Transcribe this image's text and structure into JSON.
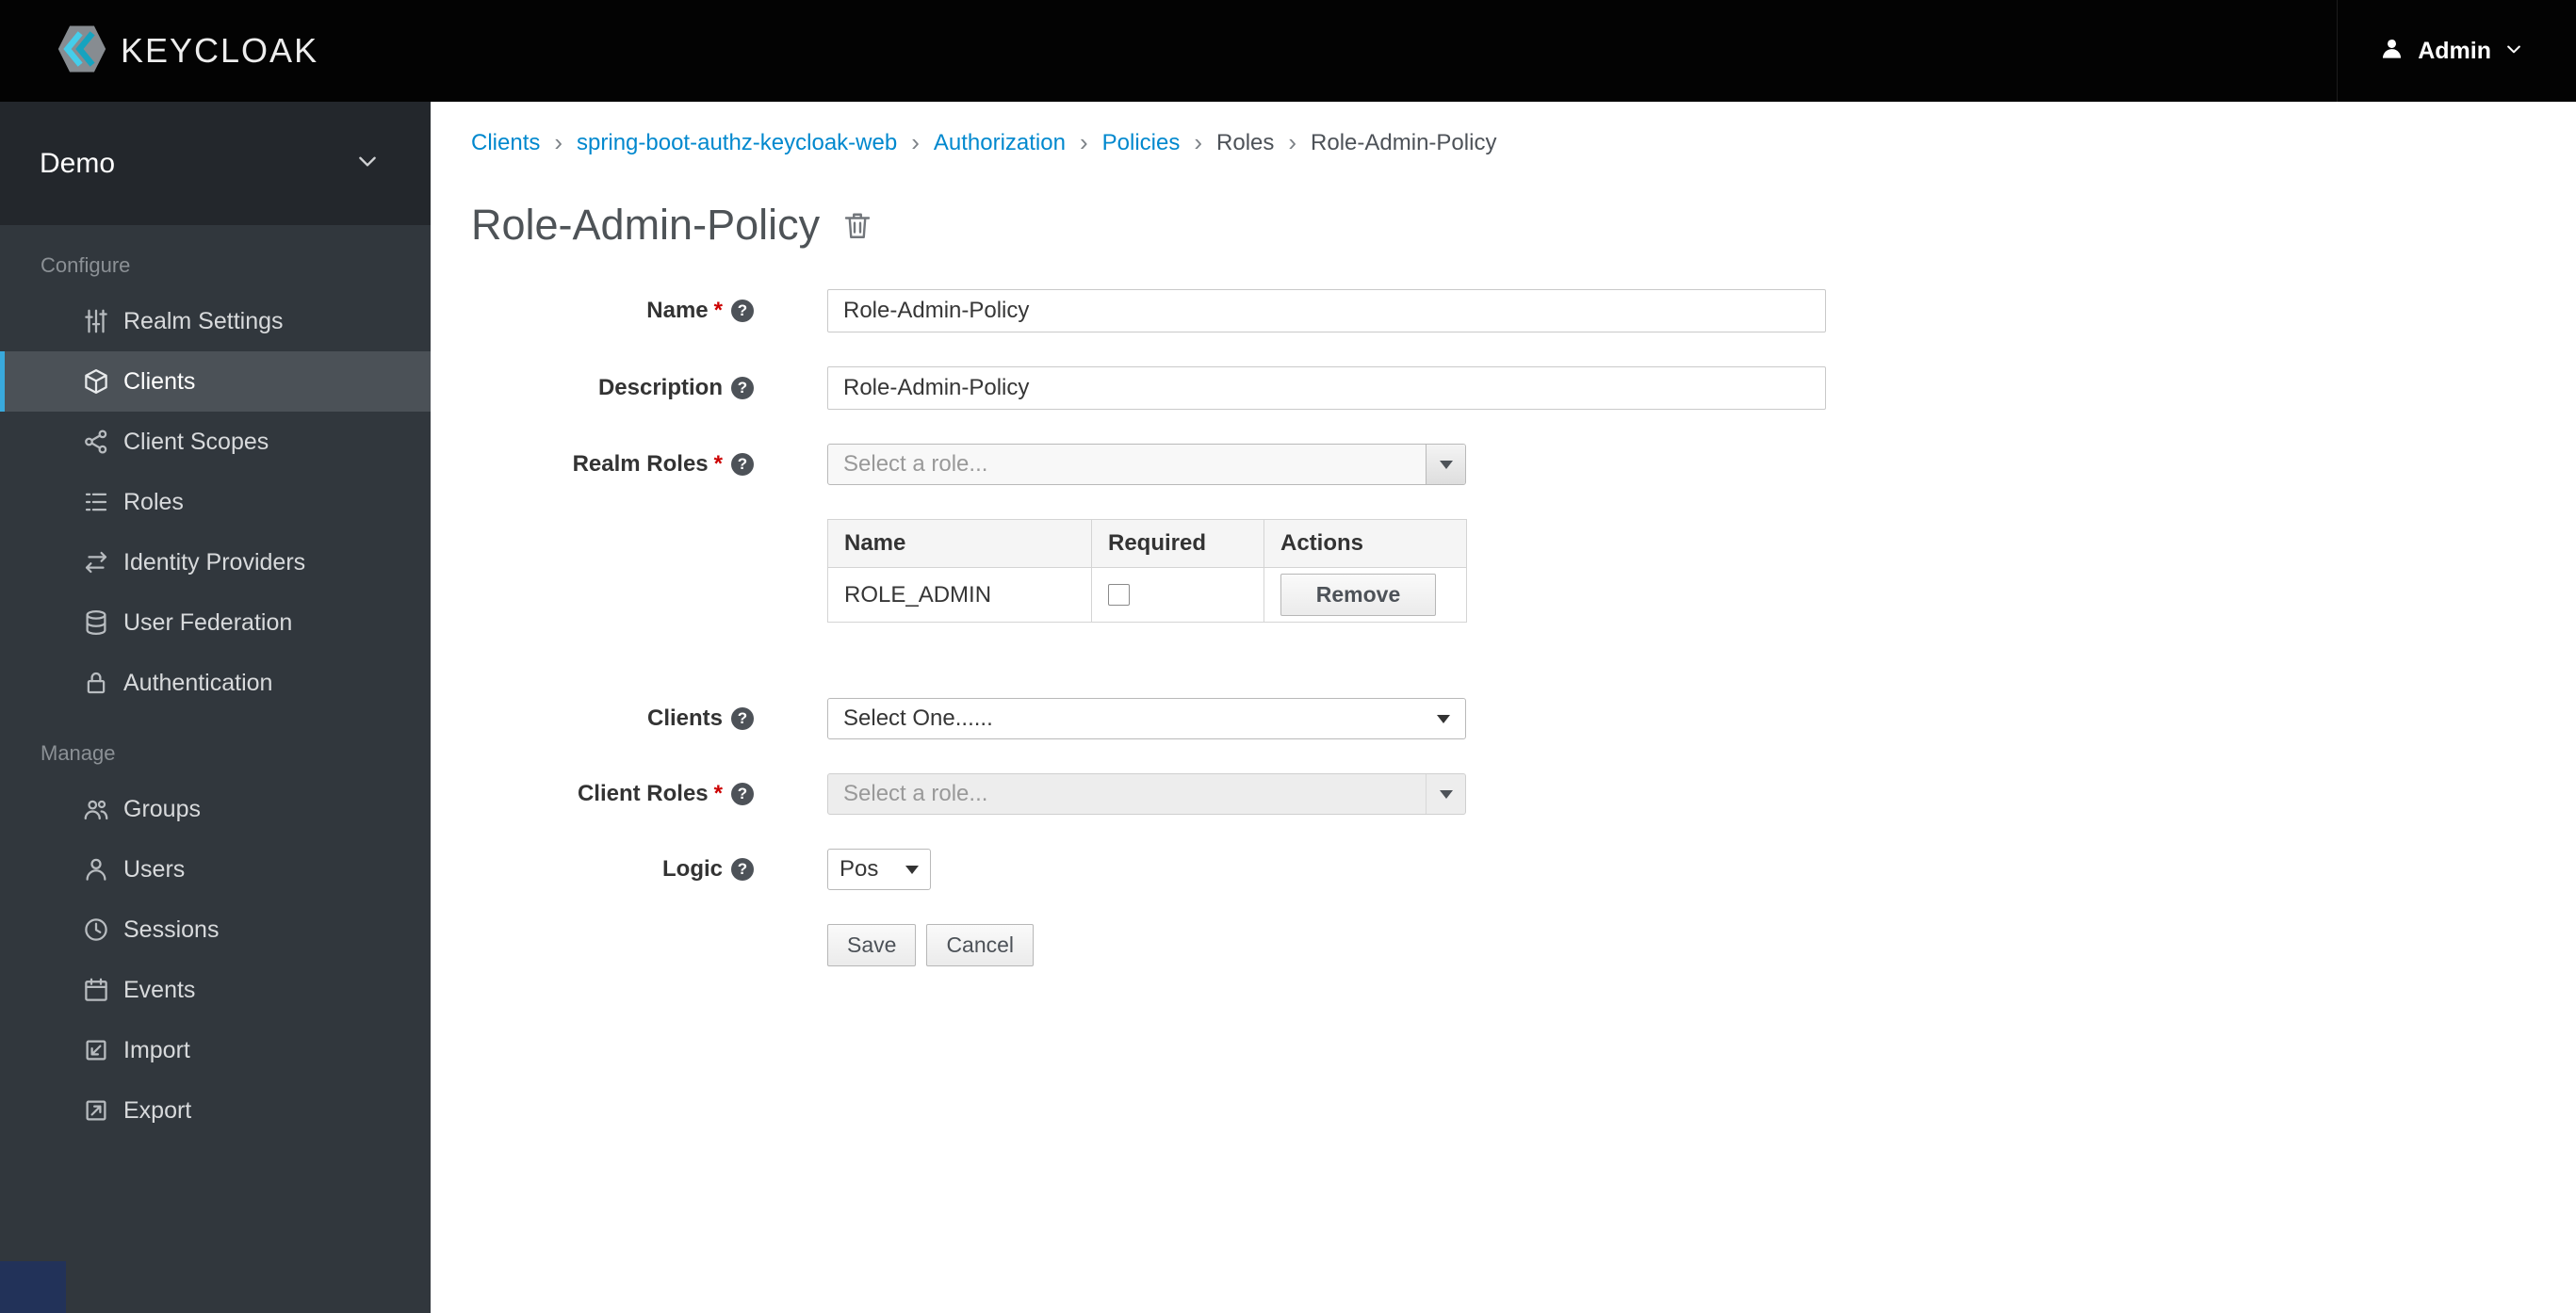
{
  "topbar": {
    "logo_text": "KEYCLOAK",
    "user_menu_label": "Admin"
  },
  "sidebar": {
    "realm_selector": {
      "label": "Demo"
    },
    "sections": [
      {
        "label": "Configure",
        "items": [
          {
            "label": "Realm Settings",
            "icon": "sliders-icon",
            "active": false
          },
          {
            "label": "Clients",
            "icon": "cube-icon",
            "active": true
          },
          {
            "label": "Client Scopes",
            "icon": "share-nodes-icon",
            "active": false
          },
          {
            "label": "Roles",
            "icon": "list-icon",
            "active": false
          },
          {
            "label": "Identity Providers",
            "icon": "exchange-icon",
            "active": false
          },
          {
            "label": "User Federation",
            "icon": "database-icon",
            "active": false
          },
          {
            "label": "Authentication",
            "icon": "lock-icon",
            "active": false
          }
        ]
      },
      {
        "label": "Manage",
        "items": [
          {
            "label": "Groups",
            "icon": "users-group-icon",
            "active": false
          },
          {
            "label": "Users",
            "icon": "user-icon",
            "active": false
          },
          {
            "label": "Sessions",
            "icon": "clock-icon",
            "active": false
          },
          {
            "label": "Events",
            "icon": "calendar-icon",
            "active": false
          },
          {
            "label": "Import",
            "icon": "import-icon",
            "active": false
          },
          {
            "label": "Export",
            "icon": "export-icon",
            "active": false
          }
        ]
      }
    ]
  },
  "breadcrumb": {
    "separator": "›",
    "items": [
      {
        "label": "Clients",
        "link": true
      },
      {
        "label": "spring-boot-authz-keycloak-web",
        "link": true
      },
      {
        "label": "Authorization",
        "link": true
      },
      {
        "label": "Policies",
        "link": true
      },
      {
        "label": "Roles",
        "link": false
      },
      {
        "label": "Role-Admin-Policy",
        "link": false
      }
    ]
  },
  "page": {
    "title": "Role-Admin-Policy"
  },
  "icons": {
    "help": "?"
  },
  "form": {
    "required_marker": "*",
    "name": {
      "label": "Name",
      "required": true,
      "value": "Role-Admin-Policy"
    },
    "description": {
      "label": "Description",
      "required": false,
      "value": "Role-Admin-Policy"
    },
    "realm_roles": {
      "label": "Realm Roles",
      "required": true,
      "placeholder": "Select a role..."
    },
    "roles_table": {
      "headers": [
        "Name",
        "Required",
        "Actions"
      ],
      "rows": [
        {
          "name": "ROLE_ADMIN",
          "required_checked": false,
          "action": "Remove"
        }
      ]
    },
    "clients": {
      "label": "Clients",
      "value": "Select One......"
    },
    "client_roles": {
      "label": "Client Roles",
      "required": true,
      "placeholder": "Select a role..."
    },
    "logic": {
      "label": "Logic",
      "value": "Pos"
    },
    "buttons": {
      "save": "Save",
      "cancel": "Cancel"
    }
  },
  "theme": {
    "topbar_bg": "#030303",
    "sidebar_bg": "#31373d",
    "active_item_accent": "#39a9dc",
    "link_color": "#0088ce",
    "required_color": "#cc0000",
    "title_color": "#4e5357"
  }
}
